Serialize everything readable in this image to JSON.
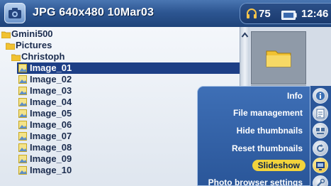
{
  "header": {
    "title": "JPG 640x480 10Mar03",
    "volume": "75",
    "clock": "12:46"
  },
  "browser": {
    "tree": [
      {
        "label": "Gmini500",
        "type": "folder",
        "level": 0
      },
      {
        "label": "Pictures",
        "type": "folder",
        "level": 1
      },
      {
        "label": "Christoph",
        "type": "folder",
        "level": 2
      }
    ],
    "files": [
      {
        "label": "Image_01",
        "selected": true
      },
      {
        "label": "Image_02",
        "selected": false
      },
      {
        "label": "Image_03",
        "selected": false
      },
      {
        "label": "Image_04",
        "selected": false
      },
      {
        "label": "Image_05",
        "selected": false
      },
      {
        "label": "Image_06",
        "selected": false
      },
      {
        "label": "Image_07",
        "selected": false
      },
      {
        "label": "Image_08",
        "selected": false
      },
      {
        "label": "Image_09",
        "selected": false
      },
      {
        "label": "Image_10",
        "selected": false
      }
    ]
  },
  "menu": {
    "items": [
      {
        "label": "Info",
        "icon": "info-icon",
        "active": false
      },
      {
        "label": "File management",
        "icon": "file-management-icon",
        "active": false
      },
      {
        "label": "Hide thumbnails",
        "icon": "hide-thumbnails-icon",
        "active": false
      },
      {
        "label": "Reset thumbnails",
        "icon": "reset-thumbnails-icon",
        "active": false
      },
      {
        "label": "Slideshow",
        "icon": "slideshow-icon",
        "active": true
      },
      {
        "label": "Photo browser settings",
        "icon": "settings-icon",
        "active": false
      }
    ]
  },
  "colors": {
    "header_bg": "#2d5692",
    "selection_bg": "#1d3f86",
    "menu_bg": "#2f5ea3",
    "menu_active": "#f2d33c",
    "folder_yellow": "#f1c232"
  }
}
